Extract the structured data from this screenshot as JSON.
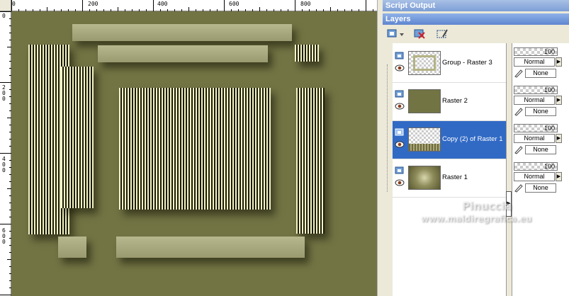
{
  "rulers": {
    "top_labels": [
      "0",
      "200",
      "400",
      "600",
      "800"
    ],
    "left_labels": [
      "0",
      "2\n0\n0",
      "4\n0\n0",
      "6\n0\n0"
    ]
  },
  "panels": {
    "script_output": {
      "title": "Script Output"
    },
    "layers": {
      "title": "Layers",
      "toolbar": {
        "new_layer_icon": "new-raster-layer-icon",
        "delete_icon": "delete-layer-icon",
        "properties_icon": "layer-properties-icon"
      },
      "items": [
        {
          "name": "Group - Raster 3",
          "opacity": "100",
          "blend": "Normal",
          "link": "None",
          "selected": false
        },
        {
          "name": "Raster 2",
          "opacity": "100",
          "blend": "Normal",
          "link": "None",
          "selected": false
        },
        {
          "name": "Copy (2) of Raster 1",
          "opacity": "100",
          "blend": "Normal",
          "link": "None",
          "selected": true
        },
        {
          "name": "Raster 1",
          "opacity": "100",
          "blend": "Normal",
          "link": "None",
          "selected": false
        }
      ]
    }
  },
  "watermark": {
    "line1": "Pinuccia",
    "line2": "www.maldiregrafica.eu"
  },
  "colors": {
    "canvas": "#727444",
    "selection": "#316ac5",
    "title_bar": "#5e86d0"
  }
}
